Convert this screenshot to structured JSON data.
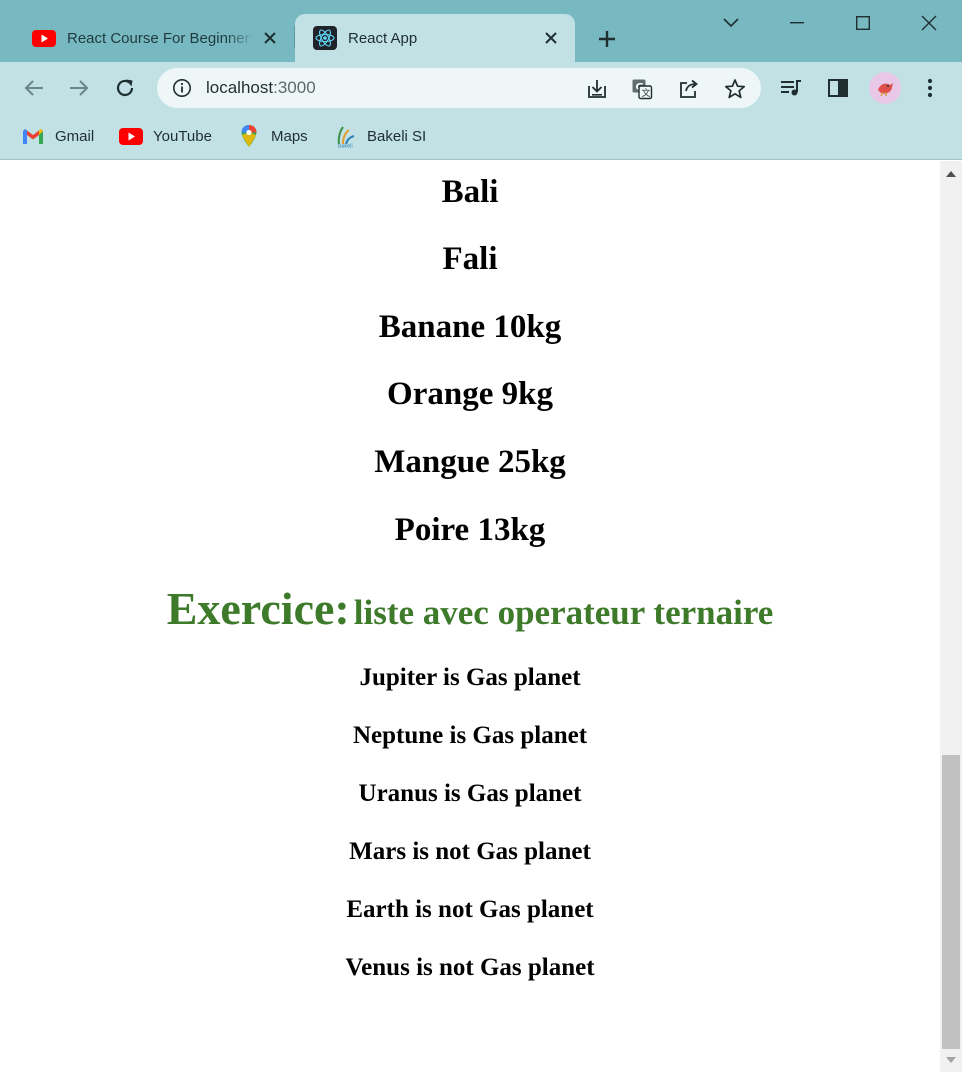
{
  "browser": {
    "tabs": [
      {
        "title": "React Course For Beginners",
        "favicon": "youtube-icon",
        "active": false
      },
      {
        "title": "React App",
        "favicon": "react-icon",
        "active": true
      }
    ],
    "address": {
      "host": "localhost",
      "port": ":3000"
    },
    "bookmarks": [
      {
        "label": "Gmail",
        "icon": "gmail-icon"
      },
      {
        "label": "YouTube",
        "icon": "youtube-icon"
      },
      {
        "label": "Maps",
        "icon": "maps-icon"
      },
      {
        "label": "Bakeli SI",
        "icon": "bakeli-icon"
      }
    ],
    "colors": {
      "tabstrip": "#78b9c1",
      "toolbar": "#c1e1e4",
      "omnibox": "#eef6f7"
    }
  },
  "page": {
    "items": [
      "Bali",
      "Fali",
      "Banane 10kg",
      "Orange 9kg",
      "Mangue 25kg",
      "Poire 13kg"
    ],
    "exercise": {
      "label": "Exercice:",
      "subtitle": "liste avec operateur ternaire",
      "color": "#3d7a2a"
    },
    "planets": [
      "Jupiter is Gas planet",
      "Neptune is Gas planet",
      "Uranus is Gas planet",
      "Mars is not Gas planet",
      "Earth is not Gas planet",
      "Venus is not Gas planet"
    ]
  }
}
